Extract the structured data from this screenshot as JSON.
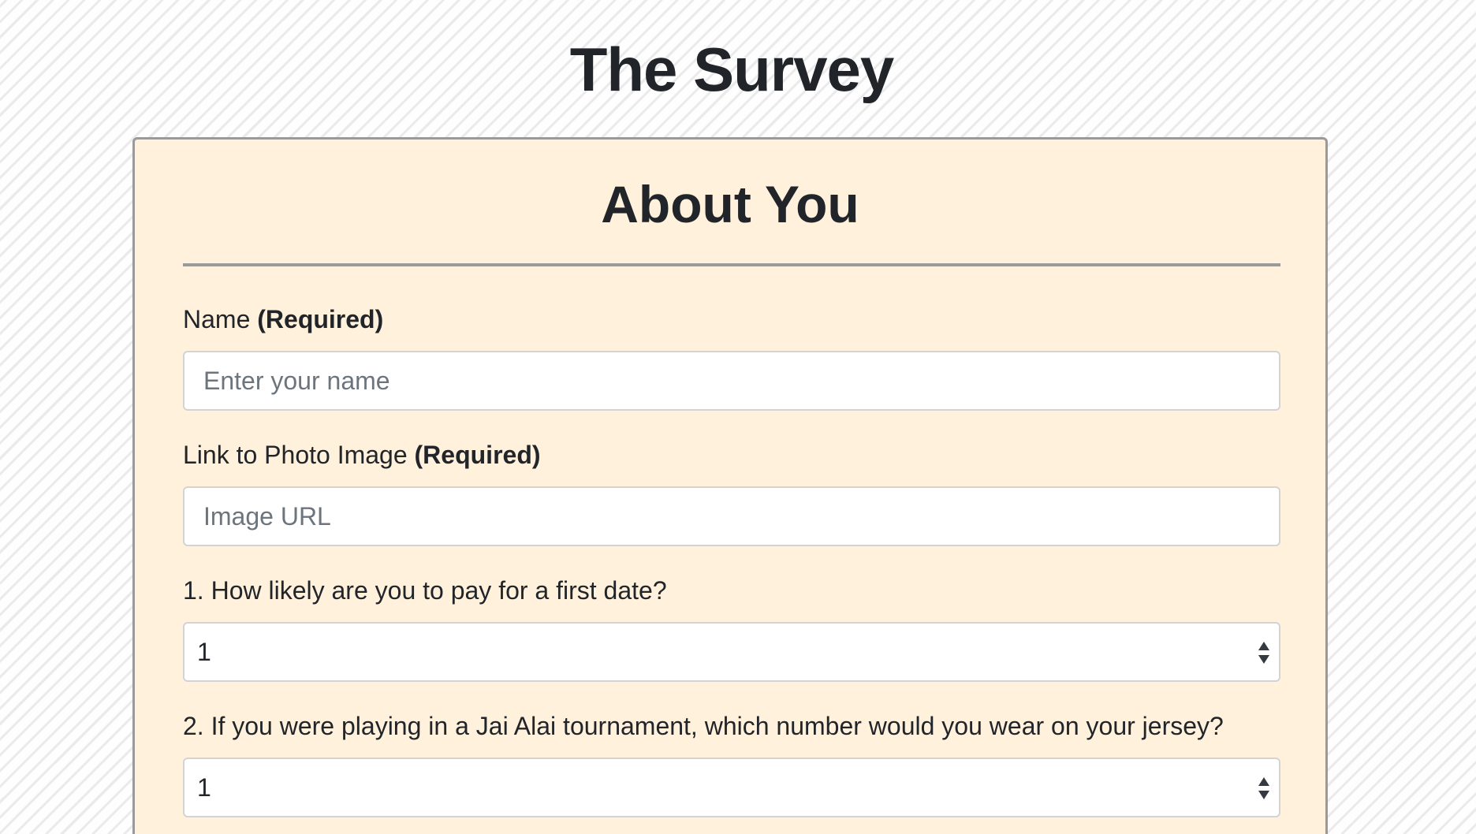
{
  "page": {
    "title": "The Survey"
  },
  "section": {
    "title": "About You"
  },
  "fields": {
    "name": {
      "label": "Name",
      "required_label": "(Required)",
      "placeholder": "Enter your name",
      "value": ""
    },
    "photo": {
      "label": "Link to Photo Image",
      "required_label": "(Required)",
      "placeholder": "Image URL",
      "value": ""
    }
  },
  "questions": [
    {
      "label": "1. How likely are you to pay for a first date?",
      "selected": "1"
    },
    {
      "label": "2. If you were playing in a Jai Alai tournament, which number would you wear on your jersey?",
      "selected": "1"
    }
  ],
  "colors": {
    "card_background": "#fff1dc",
    "card_border": "#9a9a9a",
    "text": "#212529",
    "placeholder": "#6c757d",
    "input_border": "#d3d3d3"
  },
  "icons": {
    "select_arrow": "updown-chevron-icon"
  }
}
